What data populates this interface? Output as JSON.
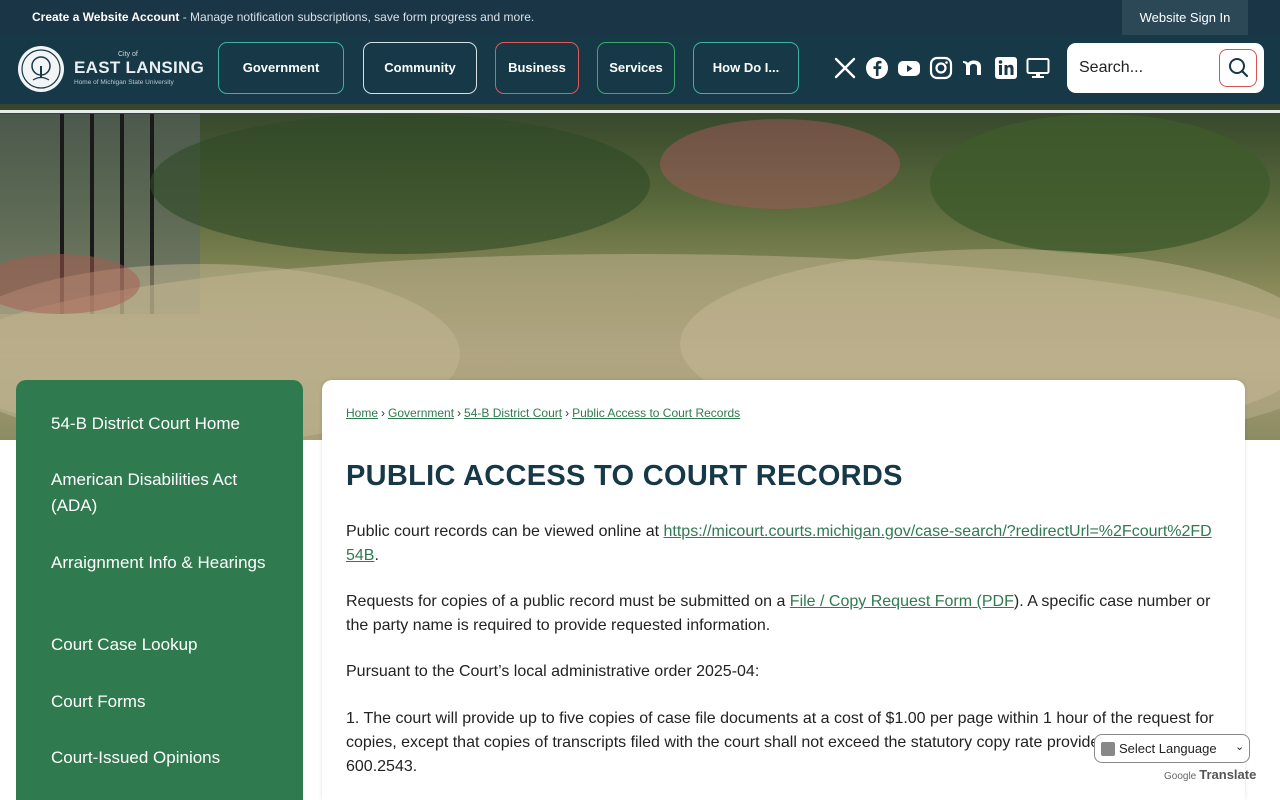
{
  "topbar": {
    "create_account": "Create a Website Account",
    "create_account_desc": " - Manage notification subscriptions, save form progress and more.",
    "sign_in": "Website Sign In"
  },
  "logo": {
    "city_small": "City of",
    "city_name": "EAST LANSING",
    "tagline": "Home of Michigan State University"
  },
  "nav": [
    {
      "label": "Government",
      "border": "#3fb1a3"
    },
    {
      "label": "Community",
      "border": "#d7e0e6"
    },
    {
      "label": "Business",
      "border": "#e05a5a"
    },
    {
      "label": "Services",
      "border": "#3fa86f"
    },
    {
      "label": "How Do I...",
      "border": "#3fb1a3"
    }
  ],
  "social_icons": [
    "x-icon",
    "facebook-icon",
    "youtube-icon",
    "instagram-icon",
    "nextdoor-icon",
    "linkedin-icon",
    "monitor-icon"
  ],
  "search": {
    "placeholder": "Search..."
  },
  "sidebar": {
    "items": [
      {
        "label": "54-B District Court Home"
      },
      {
        "label": "American Disabilities Act (ADA)"
      },
      {
        "label": "Arraignment Info & Hearings"
      },
      {
        "label": "Court Case Lookup"
      },
      {
        "label": "Court Forms"
      },
      {
        "label": "Court-Issued Opinions"
      }
    ]
  },
  "breadcrumb": [
    "Home",
    "Government",
    "54-B District Court",
    "Public Access to Court Records"
  ],
  "page": {
    "title": "PUBLIC ACCESS TO COURT RECORDS",
    "p1_text": "Public court records can be viewed online at ",
    "p1_link": "https://micourt.courts.michigan.gov/case-search/?redirectUrl=%2Fcourt%2FD54B",
    "p1_end": ".",
    "p2_text": "Requests for copies of a public record must be submitted on a ",
    "p2_link": "File / Copy Request Form (PDF",
    "p2_end": "). A specific case number or the party name is required to provide requested information.",
    "p3": "Pursuant to the Court’s local administrative order 2025-04:",
    "p4": "1. The court will provide up to five copies of case file documents at a cost of $1.00 per page within 1 hour of the request for copies, except that copies of transcripts filed with the court shall not exceed the statutory copy rate provided in MCL 600.2543."
  },
  "translate": {
    "select_label": "Select Language",
    "powered_by": "Google",
    "translate_word": "Translate"
  },
  "colors": {
    "header": "#163847",
    "sidebar": "#2f7a4f",
    "link": "#2f7a4f"
  }
}
